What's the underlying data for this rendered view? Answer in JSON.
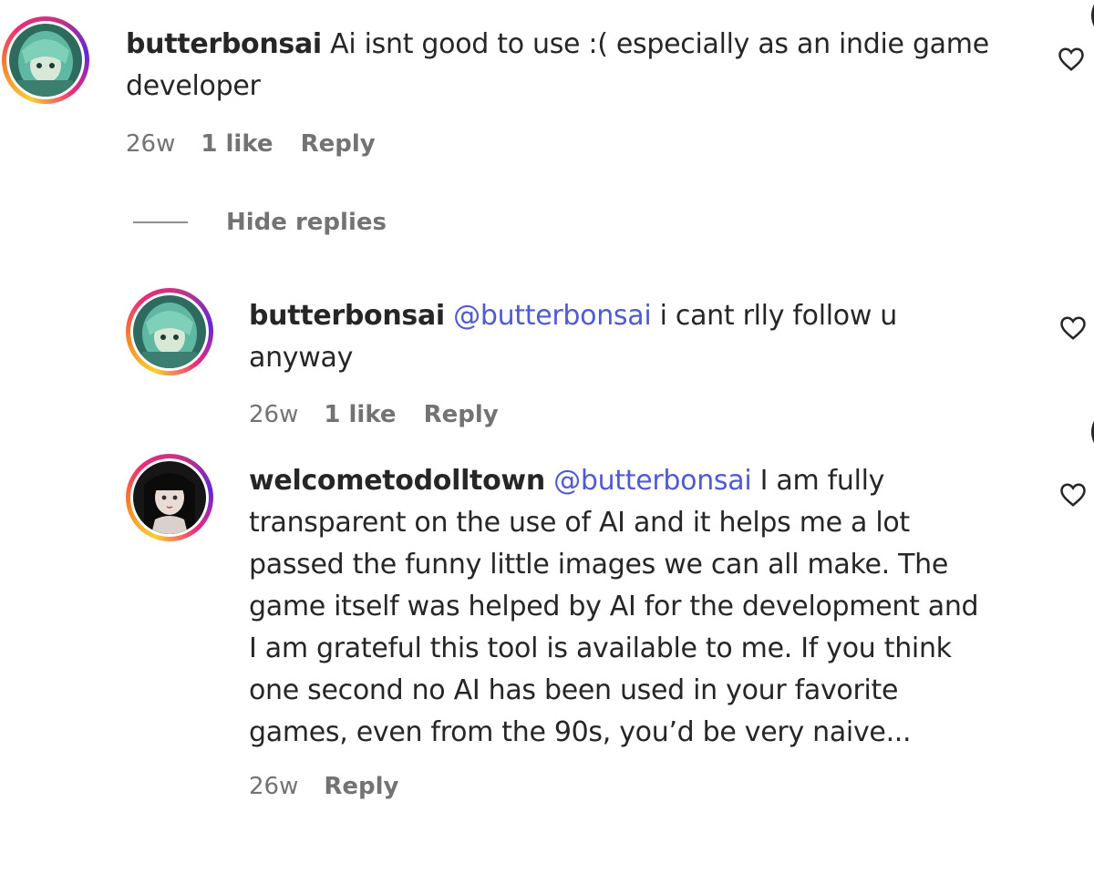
{
  "comments": [
    {
      "username": "butterbonsai",
      "mention": "",
      "lines": [
        "Ai isnt good to use :( especially as an indie game",
        "developer"
      ],
      "time": "26w",
      "likes": "1 like",
      "reply": "Reply"
    }
  ],
  "hide_replies_label": "Hide replies",
  "replies": [
    {
      "username": "butterbonsai",
      "mention": "@butterbonsai",
      "lines": [
        "i cant rlly follow u",
        "anyway"
      ],
      "time": "26w",
      "likes": "1 like",
      "reply": "Reply"
    },
    {
      "username": "welcometodolltown",
      "mention": "@butterbonsai",
      "lines": [
        "I am fully",
        "transparent on the use of AI and it helps me a lot",
        "passed the funny little images we can all make. The",
        "game itself was helped by AI for the development and",
        "I am grateful this tool is available to me. If you think",
        "one second no AI has been used in your favorite",
        "games, even from the 90s, you’d be very naive..."
      ],
      "time": "26w",
      "reply": "Reply"
    }
  ],
  "icons": {
    "like": "heart-outline-icon",
    "avatar_butterbonsai": "teal-haired-character-avatar",
    "avatar_welcometodolltown": "doll-face-avatar"
  },
  "colors": {
    "text": "#262626",
    "muted": "#737373",
    "mention": "#4f5bd5"
  }
}
